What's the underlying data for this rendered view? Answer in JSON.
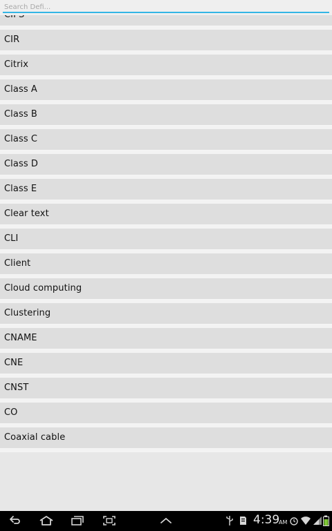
{
  "search": {
    "placeholder": "Search Defi..."
  },
  "list": {
    "partial_top_label": "CIPS",
    "items": [
      "CIR",
      "Citrix",
      "Class A",
      "Class B",
      "Class C",
      "Class D",
      "Class E",
      "Clear text",
      "CLI",
      "Client",
      "Cloud computing",
      "Clustering",
      "CNAME",
      "CNE",
      "CNST",
      "CO",
      "Coaxial cable"
    ]
  },
  "navbar": {
    "icons": [
      "back-icon",
      "home-icon",
      "recent-apps-icon",
      "screenshot-icon",
      "up-chevron-icon"
    ]
  },
  "status": {
    "time": "4:39",
    "ampm": "AM",
    "icons": [
      "usb-icon",
      "sd-card-icon",
      "alarm-icon",
      "wifi-icon",
      "signal-icon",
      "battery-icon"
    ]
  },
  "colors": {
    "accent": "#33b5e5",
    "row_bg": "#dedede",
    "separator": "#f5f5f5",
    "navbar_bg": "#000000"
  }
}
